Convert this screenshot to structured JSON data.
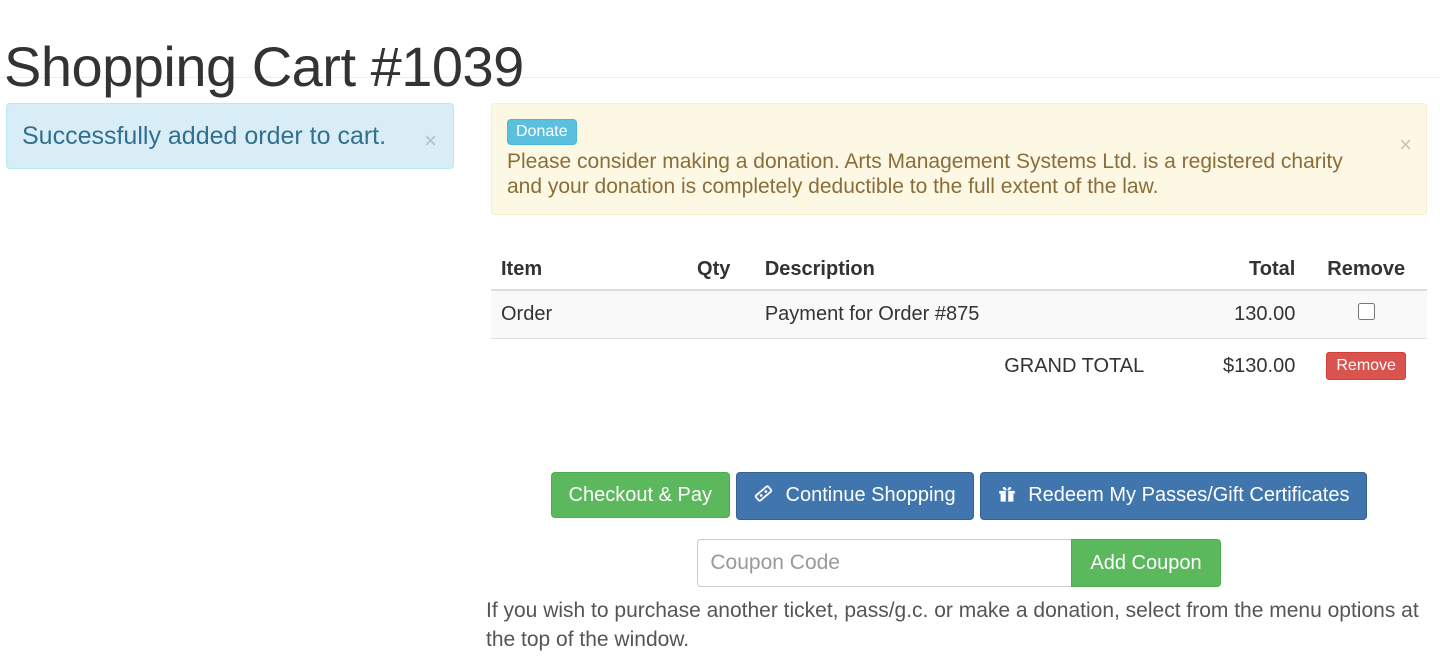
{
  "page": {
    "title": "Shopping Cart #1039"
  },
  "success_alert": {
    "message": "Successfully added order to cart.",
    "close_label": "×",
    "bg_color": "#d9edf7",
    "text_color": "#31708f"
  },
  "donation_alert": {
    "badge_label": "Donate",
    "message": "Please consider making a donation. Arts Management Systems Ltd. is a registered charity and your donation is completely deductible to the full extent of the law.",
    "close_label": "×",
    "bg_color": "#fcf8e3",
    "text_color": "#8a6d3b",
    "badge_color": "#5bc0de"
  },
  "cart_table": {
    "headers": {
      "item": "Item",
      "qty": "Qty",
      "description": "Description",
      "spacer": "",
      "total": "Total",
      "remove": "Remove"
    },
    "rows": [
      {
        "item": "Order",
        "qty": "",
        "description": "Payment for Order #875",
        "spacer": "",
        "total": "130.00",
        "checkbox_checked": false
      }
    ],
    "grand_total": {
      "label": "GRAND TOTAL",
      "value": "$130.00",
      "remove_label": "Remove",
      "remove_color": "#d9534f"
    }
  },
  "actions": {
    "checkout": {
      "label": "Checkout & Pay",
      "color": "#5cb85c"
    },
    "continue_shopping": {
      "label": "Continue Shopping",
      "icon": "ticket-icon",
      "color": "#4076ad"
    },
    "redeem": {
      "label": "Redeem My Passes/Gift Certificates",
      "icon": "gift-icon",
      "color": "#4076ad"
    }
  },
  "coupon": {
    "placeholder": "Coupon Code",
    "value": "",
    "button_label": "Add Coupon"
  },
  "footer": {
    "note": "If you wish to purchase another ticket, pass/g.c. or make a donation, select from the menu options at the top of the window."
  }
}
